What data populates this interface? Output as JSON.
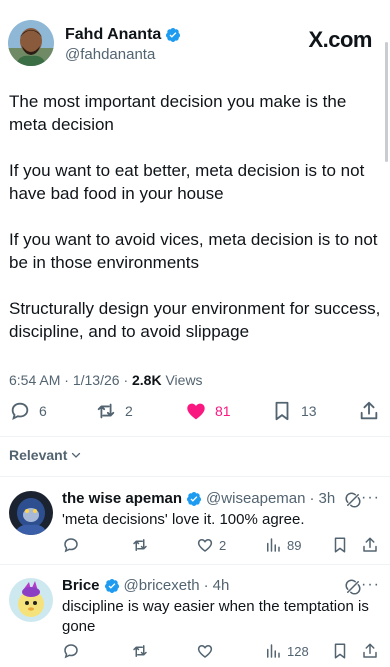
{
  "tweet": {
    "author_name": "Fahd Ananta",
    "author_handle": "@fahdananta",
    "site_label": "X.com",
    "paragraphs": [
      "The most important decision you make is the meta decision",
      "If you want to eat better, meta decision is to not have bad food in your house",
      "If you want to avoid vices, meta decision is to not be in those environments",
      "Structurally design your environment for success, discipline, and to avoid slippage"
    ],
    "time": "6:54 AM",
    "date": "1/13/26",
    "views_count": "2.8K",
    "views_label": "Views",
    "separator": "·",
    "stats": {
      "replies": "6",
      "reposts": "2",
      "likes": "81",
      "bookmarks": "13"
    },
    "liked": true,
    "colors": {
      "like": "#f91880",
      "verified": "#1d9bf0",
      "muted": "#536471"
    }
  },
  "replies_filter": "Relevant",
  "replies": [
    {
      "name": "the wise apeman",
      "handle": "@wiseapeman",
      "time": "3h",
      "text": "'meta decisions' love it. 100% agree.",
      "likes": "2",
      "views": "89"
    },
    {
      "name": "Brice",
      "handle": "@bricexeth",
      "time": "4h",
      "text": "discipline is way easier when the temptation is gone",
      "likes": "",
      "views": "128"
    }
  ],
  "icons": [
    "reply-icon",
    "repost-icon",
    "heart-icon",
    "views-icon",
    "bookmark-icon",
    "share-icon",
    "grok-icon",
    "more-icon",
    "verified-icon",
    "chevron-down-icon"
  ]
}
